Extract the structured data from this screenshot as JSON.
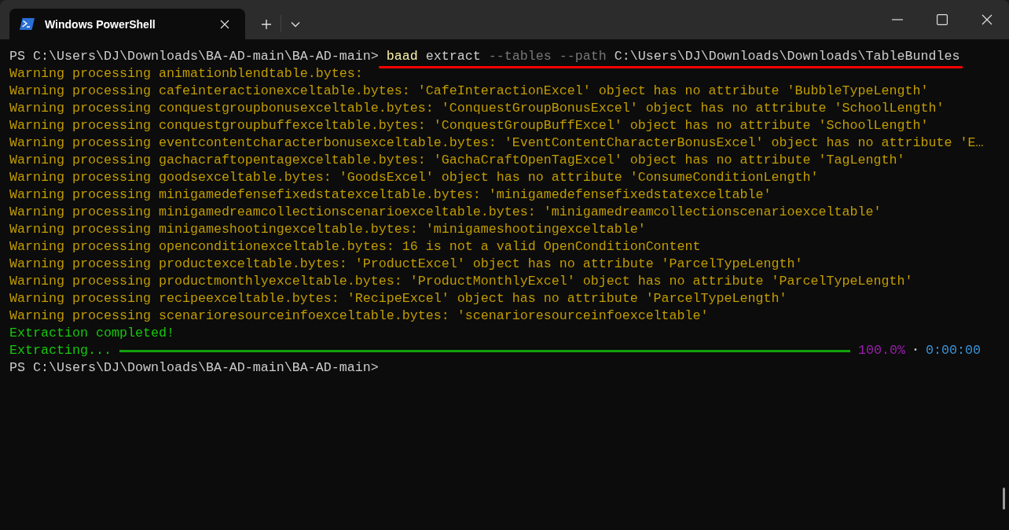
{
  "window": {
    "tabs": [
      {
        "title": "Windows PowerShell",
        "selected": true
      }
    ]
  },
  "terminal": {
    "lines": [
      {
        "kind": "command",
        "prompt": "PS C:\\Users\\DJ\\Downloads\\BA-AD-main\\BA-AD-main>",
        "program": "baad",
        "subcommand": "extract",
        "flags": "--tables --path",
        "argument": "C:\\Users\\DJ\\Downloads\\Downloads\\TableBundles",
        "underlined": true
      },
      {
        "kind": "warning",
        "text": "Warning processing animationblendtable.bytes:"
      },
      {
        "kind": "warning",
        "text": "Warning processing cafeinteractionexceltable.bytes: 'CafeInteractionExcel' object has no attribute 'BubbleTypeLength'"
      },
      {
        "kind": "warning",
        "text": "Warning processing conquestgroupbonusexceltable.bytes: 'ConquestGroupBonusExcel' object has no attribute 'SchoolLength'"
      },
      {
        "kind": "warning",
        "text": "Warning processing conquestgroupbuffexceltable.bytes: 'ConquestGroupBuffExcel' object has no attribute 'SchoolLength'"
      },
      {
        "kind": "warning",
        "text": "Warning processing eventcontentcharacterbonusexceltable.bytes: 'EventContentCharacterBonusExcel' object has no attribute 'E…"
      },
      {
        "kind": "warning",
        "text": "Warning processing gachacraftopentagexceltable.bytes: 'GachaCraftOpenTagExcel' object has no attribute 'TagLength'"
      },
      {
        "kind": "warning",
        "text": "Warning processing goodsexceltable.bytes: 'GoodsExcel' object has no attribute 'ConsumeConditionLength'"
      },
      {
        "kind": "warning",
        "text": "Warning processing minigamedefensefixedstatexceltable.bytes: 'minigamedefensefixedstatexceltable'"
      },
      {
        "kind": "warning",
        "text": "Warning processing minigamedreamcollectionscenarioexceltable.bytes: 'minigamedreamcollectionscenarioexceltable'"
      },
      {
        "kind": "warning",
        "text": "Warning processing minigameshootingexceltable.bytes: 'minigameshootingexceltable'"
      },
      {
        "kind": "warning",
        "text": "Warning processing openconditionexceltable.bytes: 16 is not a valid OpenConditionContent"
      },
      {
        "kind": "warning",
        "text": "Warning processing productexceltable.bytes: 'ProductExcel' object has no attribute 'ParcelTypeLength'"
      },
      {
        "kind": "warning",
        "text": "Warning processing productmonthlyexceltable.bytes: 'ProductMonthlyExcel' object has no attribute 'ParcelTypeLength'"
      },
      {
        "kind": "warning",
        "text": "Warning processing recipeexceltable.bytes: 'RecipeExcel' object has no attribute 'ParcelTypeLength'"
      },
      {
        "kind": "warning",
        "text": "Warning processing scenarioresourceinfoexceltable.bytes: 'scenarioresourceinfoexceltable'"
      },
      {
        "kind": "success",
        "text": "Extraction completed!"
      },
      {
        "kind": "progress",
        "label": "Extracting...",
        "level": 1.0,
        "percent": "100.0%",
        "separator": "•",
        "elapsed": "0:00:00"
      },
      {
        "kind": "prompt",
        "text": "PS C:\\Users\\DJ\\Downloads\\BA-AD-main\\BA-AD-main>"
      }
    ]
  }
}
